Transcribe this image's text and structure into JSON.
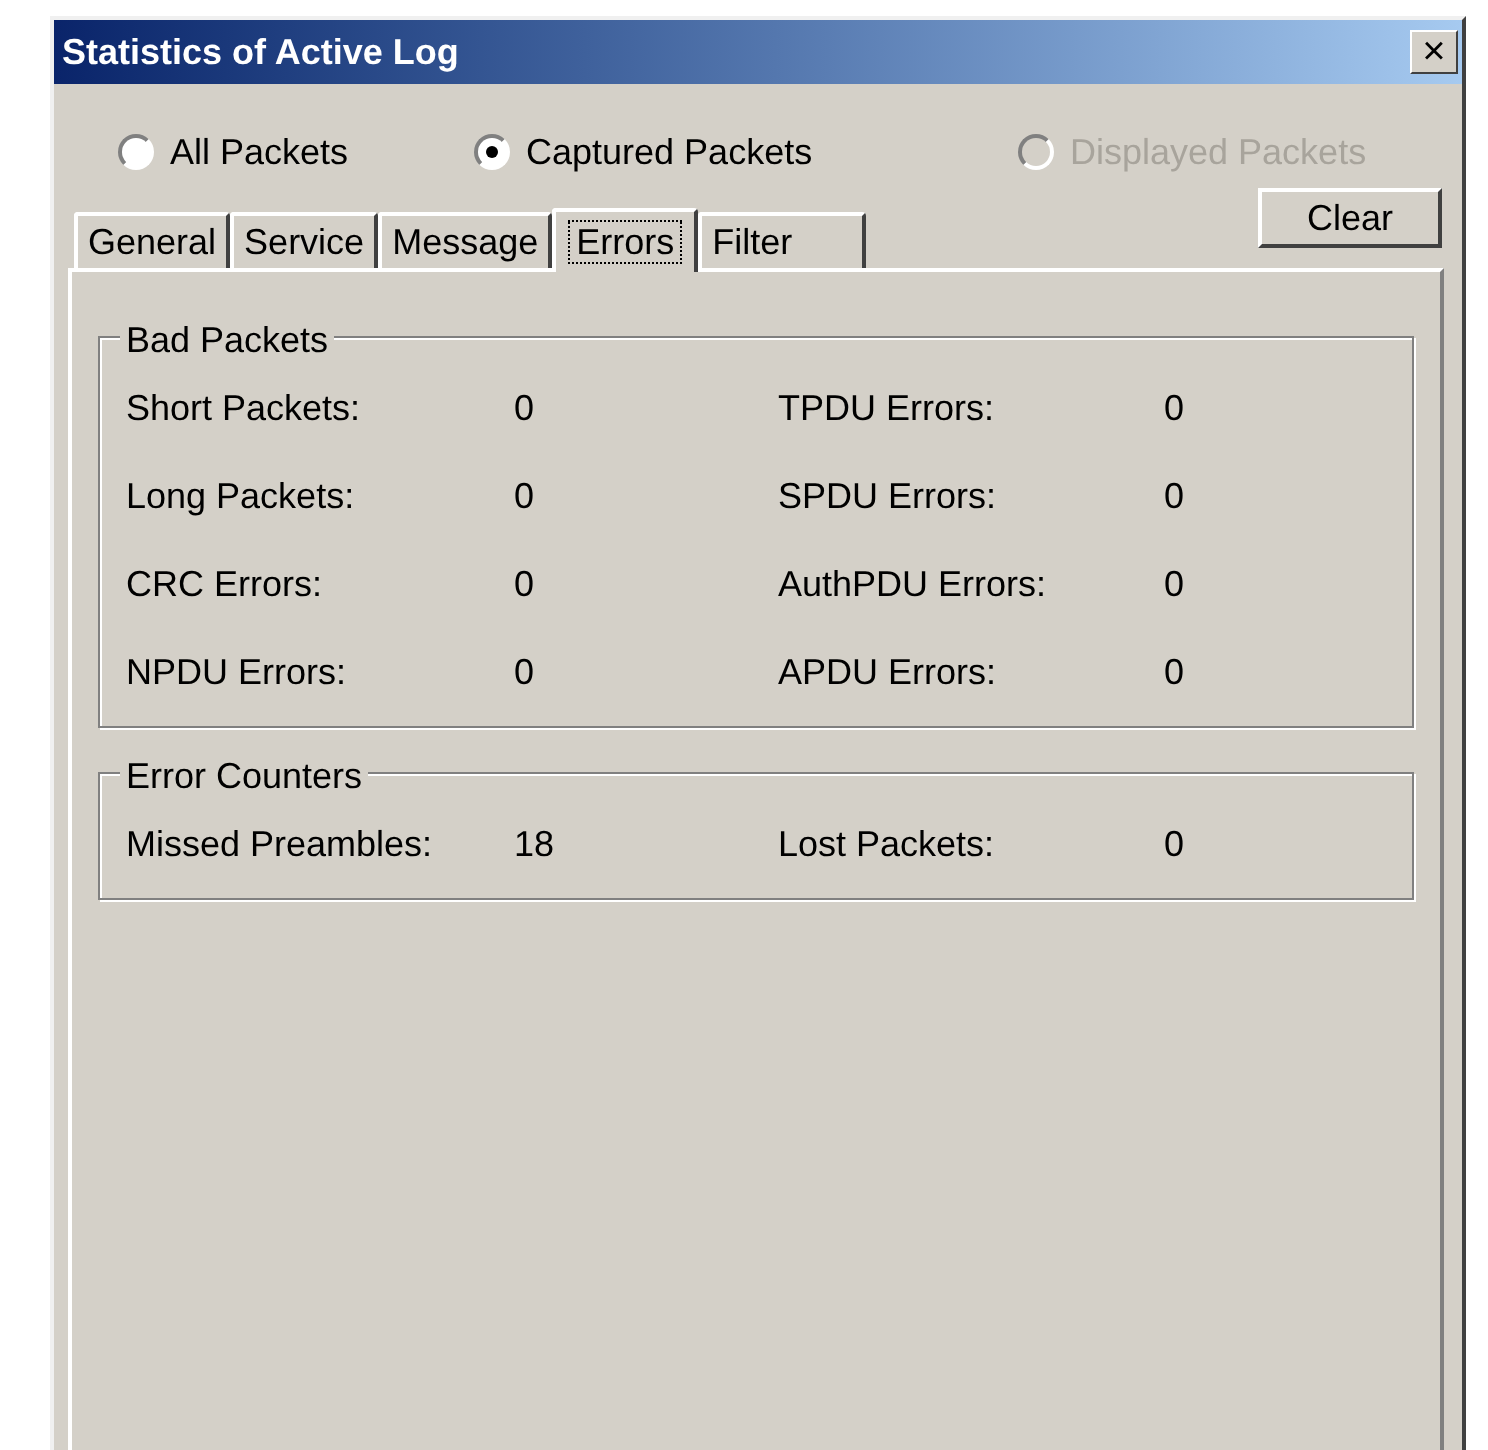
{
  "window": {
    "title": "Statistics of Active Log",
    "close": "×"
  },
  "scope": [
    {
      "label": "All Packets",
      "selected": false,
      "disabled": false
    },
    {
      "label": "Captured Packets",
      "selected": true,
      "disabled": false
    },
    {
      "label": "Displayed Packets",
      "selected": false,
      "disabled": true
    }
  ],
  "tabs": [
    {
      "label": "General",
      "selected": false
    },
    {
      "label": "Service",
      "selected": false
    },
    {
      "label": "Message",
      "selected": false
    },
    {
      "label": "Errors",
      "selected": true
    },
    {
      "label": "Filter",
      "selected": false
    }
  ],
  "clear_button": "Clear",
  "groups": [
    {
      "title": "Bad Packets",
      "rows": [
        {
          "left_label": "Short Packets:",
          "left_value": "0",
          "right_label": "TPDU Errors:",
          "right_value": "0"
        },
        {
          "left_label": "Long Packets:",
          "left_value": "0",
          "right_label": "SPDU Errors:",
          "right_value": "0"
        },
        {
          "left_label": "CRC Errors:",
          "left_value": "0",
          "right_label": "AuthPDU Errors:",
          "right_value": "0"
        },
        {
          "left_label": "NPDU Errors:",
          "left_value": "0",
          "right_label": "APDU Errors:",
          "right_value": "0"
        }
      ]
    },
    {
      "title": "Error Counters",
      "rows": [
        {
          "left_label": "Missed Preambles:",
          "left_value": "18",
          "right_label": "Lost Packets:",
          "right_value": "0"
        }
      ]
    }
  ]
}
